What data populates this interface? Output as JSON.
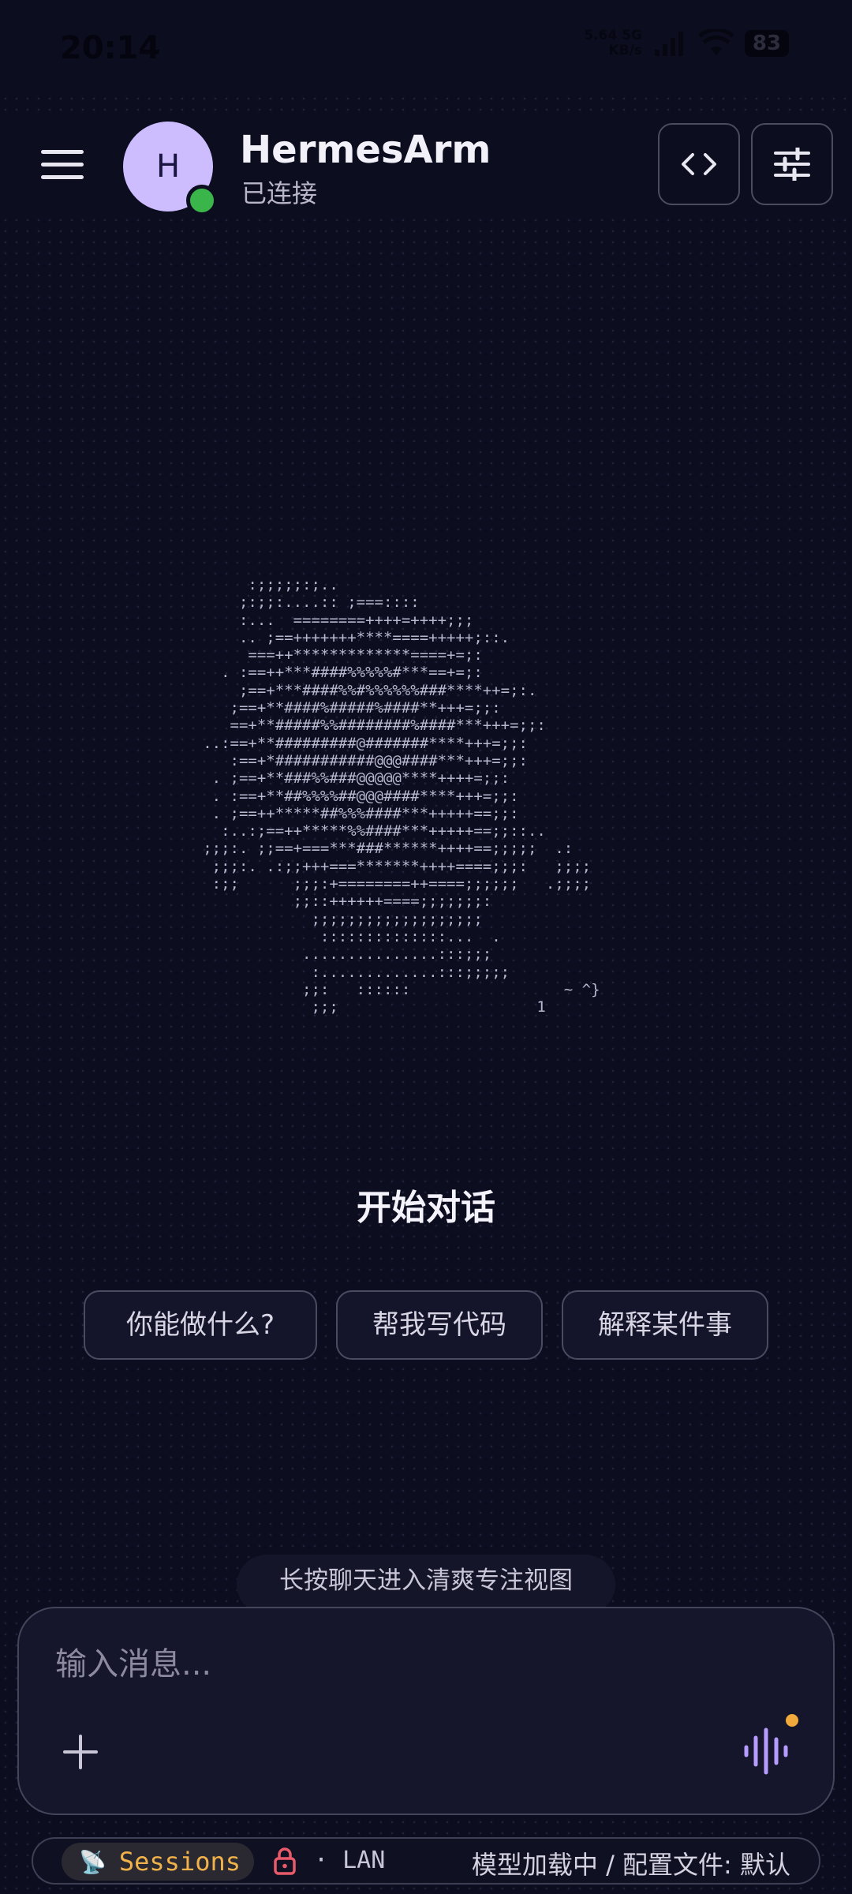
{
  "status_bar": {
    "time": "20:14",
    "net_speed_value": "5.64 5G",
    "net_speed_unit": "KB/s",
    "battery": "83"
  },
  "header": {
    "avatar_letter": "H",
    "title": "HermesArm",
    "status": "已连接"
  },
  "ascii_art": "          :;;;;;:;..\n         ;:;;:....:: ;===::::\n         :...  ========++++=++++;;;\n         .. ;==+++++++****====+++++;::.\n          ===++*************====+=;:\n       . :==++***####%%%%%#***==+=;:\n         ;==+***####%%#%%%%%%###****++=;:.\n        ;==+**####%#####%####**+++=;;:\n        ==+**#####%%########%####***+++=;;:\n     ..:==+**#########@#######****+++=;;:\n        :==+*###########@@@####***+++=;;:\n      . ;==+**###%%###@@@@@****++++=;;:\n      . :==+**##%%%%##@@@####****+++=;;:\n      . ;==++*****##%%%####***+++++==;;:\n       :..:;==++*****%%####***+++++==;;::..\n     ;;;:. ;;==+===***###******++++==;;;;;  .:\n      ;;;:. .:;;+++===*******++++====;;;:   ;;;;\n      :;;      ;;;:+========++====;;;;;;   .;;;;\n               ;;::++++++====;;;;;;;:\n                 ;;;;;;;;;;;;;;;;;;;\n                  ::::::::::::::...  .\n                ...............:::;;;\n                 :.............:::;;;;;\n                ;;:   ::::::                 ~ ^}\n                 ;;;                      1",
  "start_title": "开始对话",
  "suggestions": [
    "你能做什么?",
    "帮我写代码",
    "解释某件事"
  ],
  "hint": "长按聊天进入清爽专注视图",
  "composer": {
    "placeholder": "输入消息..."
  },
  "bottom_bar": {
    "sessions_label": "Sessions",
    "lan_label": "· LAN",
    "model_status": "模型加载中 / 配置文件: 默认"
  },
  "colors": {
    "background": "#0c0d1f",
    "avatar": "#cdbdff",
    "online": "#39b54a",
    "sessions_accent": "#f2b24a",
    "voice_accent": "#b79cff"
  }
}
